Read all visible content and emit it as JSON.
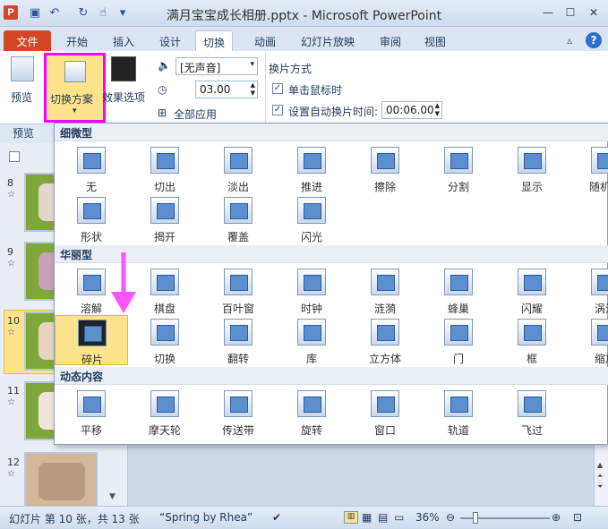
{
  "window": {
    "title": "满月宝宝成长相册.pptx - Microsoft PowerPoint",
    "app_icon": "P"
  },
  "tabs": [
    "文件",
    "开始",
    "插入",
    "设计",
    "切换",
    "动画",
    "幻灯片放映",
    "审阅",
    "视图"
  ],
  "ribbon": {
    "preview_label": "预览",
    "scheme_label": "切换方案",
    "effect_label": "效果选项",
    "sound_value": "[无声音]",
    "duration_value": "03.00",
    "apply_all_label": "全部应用",
    "advance_title": "换片方式",
    "on_click_label": "单击鼠标时",
    "auto_advance_label": "设置自动换片时间:",
    "auto_advance_value": "00:06.00",
    "preview_group_label": "预览"
  },
  "gallery": {
    "categories": [
      {
        "name": "细微型",
        "items": [
          "无",
          "切出",
          "淡出",
          "推进",
          "擦除",
          "分割",
          "显示",
          "随机线",
          "形状",
          "揭开",
          "覆盖",
          "闪光"
        ]
      },
      {
        "name": "华丽型",
        "items": [
          "溶解",
          "棋盘",
          "百叶窗",
          "时钟",
          "涟漪",
          "蜂巢",
          "闪耀",
          "涡流",
          "碎片",
          "切换",
          "翻转",
          "库",
          "立方体",
          "门",
          "框",
          "缩放"
        ]
      },
      {
        "name": "动态内容",
        "items": [
          "平移",
          "摩天轮",
          "传送带",
          "旋转",
          "窗口",
          "轨道",
          "飞过"
        ]
      }
    ],
    "selected": "碎片"
  },
  "slides": [
    {
      "num": "8"
    },
    {
      "num": "9"
    },
    {
      "num": "10"
    },
    {
      "num": "11"
    },
    {
      "num": "12"
    }
  ],
  "status": {
    "slide_info": "幻灯片 第 10 张，共 13 张",
    "theme": "“Spring by Rhea”",
    "zoom": "36%"
  },
  "colors": {
    "annotation": "#ff00ff",
    "file_tab": "#d24726",
    "selected_item": "#fde38c"
  }
}
